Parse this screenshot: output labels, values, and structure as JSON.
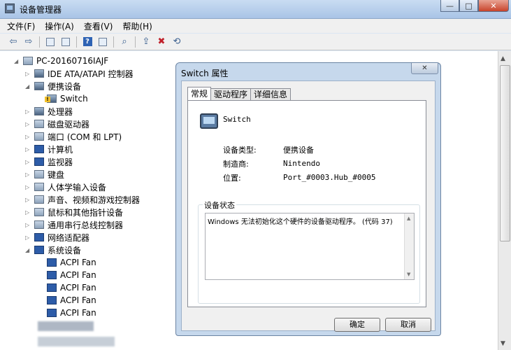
{
  "window": {
    "title": "设备管理器"
  },
  "window_buttons": {
    "minimize": "—",
    "maximize": "□",
    "close": "✕"
  },
  "menu": [
    "文件(F)",
    "操作(A)",
    "查看(V)",
    "帮助(H)"
  ],
  "toolbar_icons": [
    "back-arrow-icon",
    "forward-arrow-icon",
    "window-icon",
    "properties-icon",
    "help-icon",
    "panel-icon",
    "scan-hardware-icon",
    "update-driver-icon",
    "disable-device-icon",
    "uninstall-device-icon"
  ],
  "tree": {
    "root": "PC-20160716IAJF",
    "items": [
      {
        "label": "IDE ATA/ATAPI 控制器",
        "level": 1,
        "expanded": false
      },
      {
        "label": "便携设备",
        "level": 1,
        "expanded": true
      },
      {
        "label": "Switch",
        "level": 2,
        "warning": true
      },
      {
        "label": "处理器",
        "level": 1,
        "expanded": false
      },
      {
        "label": "磁盘驱动器",
        "level": 1,
        "expanded": false
      },
      {
        "label": "端口 (COM 和 LPT)",
        "level": 1,
        "expanded": false
      },
      {
        "label": "计算机",
        "level": 1,
        "expanded": false
      },
      {
        "label": "监视器",
        "level": 1,
        "expanded": false
      },
      {
        "label": "键盘",
        "level": 1,
        "expanded": false
      },
      {
        "label": "人体学输入设备",
        "level": 1,
        "expanded": false
      },
      {
        "label": "声音、视频和游戏控制器",
        "level": 1,
        "expanded": false
      },
      {
        "label": "鼠标和其他指针设备",
        "level": 1,
        "expanded": false
      },
      {
        "label": "通用串行总线控制器",
        "level": 1,
        "expanded": false
      },
      {
        "label": "网络适配器",
        "level": 1,
        "expanded": false
      },
      {
        "label": "系统设备",
        "level": 1,
        "expanded": true
      },
      {
        "label": "ACPI Fan",
        "level": 2
      },
      {
        "label": "ACPI Fan",
        "level": 2
      },
      {
        "label": "ACPI Fan",
        "level": 2
      },
      {
        "label": "ACPI Fan",
        "level": 2
      },
      {
        "label": "ACPI Fan",
        "level": 2
      }
    ]
  },
  "dialog": {
    "title": "Switch 属性",
    "close": "✕",
    "tabs": [
      "常规",
      "驱动程序",
      "详细信息"
    ],
    "device_name": "Switch",
    "fields": [
      {
        "label": "设备类型:",
        "value": "便携设备"
      },
      {
        "label": "制造商:",
        "value": "Nintendo"
      },
      {
        "label": "位置:",
        "value": "Port_#0003.Hub_#0005"
      }
    ],
    "status_group": "设备状态",
    "status_text": "Windows 无法初始化这个硬件的设备驱动程序。 (代码 37)",
    "ok": "确定",
    "cancel": "取消"
  }
}
